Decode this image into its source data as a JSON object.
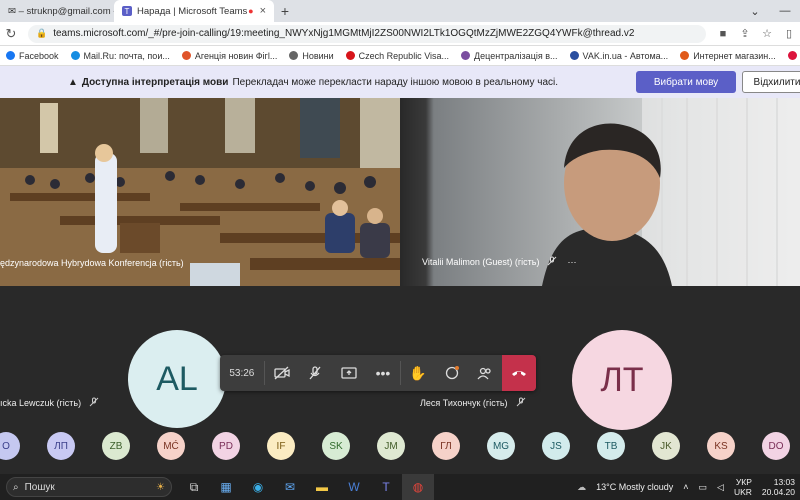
{
  "browser": {
    "tabs": [
      {
        "label": "✉ – struknp@gmail.com - Gm",
        "close": "×"
      },
      {
        "label": "Нарада | Microsoft Teams",
        "close": "×"
      }
    ],
    "new_tab": "+",
    "url": "teams.microsoft.com/_#/pre-join-calling/19:meeting_NWYxNjg1MGMtMjI2ZS00NWI2LTk1OGQtMzZjMWE2ZGQ4YWFk@thread.v2",
    "bookmarks": [
      {
        "label": "Facebook",
        "color": "#1877f2"
      },
      {
        "label": "Mail.Ru: почта, пои...",
        "color": "#168de2"
      },
      {
        "label": "Агенція новин Фігl...",
        "color": "#e0542a"
      },
      {
        "label": "Новини",
        "color": "#666666"
      },
      {
        "label": "Czech Republic Visa...",
        "color": "#d7141a"
      },
      {
        "label": "Децентралізація в...",
        "color": "#7b4fa0"
      },
      {
        "label": "VAK.in.ua - Автома...",
        "color": "#2a4fa0"
      },
      {
        "label": "Интернет магазин...",
        "color": "#e05a1a"
      },
      {
        "label": "Poland visa informa...",
        "color": "#dc143c"
      }
    ]
  },
  "banner": {
    "title": "Доступна інтерпретація мови",
    "text": "Перекладач може перекласти нараду іншою мовою в реальному часі.",
    "primary_button": "Вибрати мову",
    "secondary_button": "Відхилити"
  },
  "tiles": {
    "room_caption": "ędzynarodowa Hybrydowa Konferencja (гість)",
    "guest_caption": "Vitalii Malimon (Guest) (гість)",
    "guest_more": "···"
  },
  "participants_big": [
    {
      "initials": "AL",
      "name": "ıcka Lewczuk (гість)"
    },
    {
      "initials": "ЛТ",
      "name": "Леся Тихончук (гість)"
    }
  ],
  "call_bar": {
    "timer": "53:26"
  },
  "participants_small": [
    {
      "initials": "O",
      "bg": "#c5c8f0",
      "fg": "#3a3f8a"
    },
    {
      "initials": "ЛП",
      "bg": "#c8c9f3",
      "fg": "#3a3f8a"
    },
    {
      "initials": "ZB",
      "bg": "#dbe9d0",
      "fg": "#3b5e2a"
    },
    {
      "initials": "MĆ",
      "bg": "#f6d2c9",
      "fg": "#7a3322"
    },
    {
      "initials": "PD",
      "bg": "#f2d3e4",
      "fg": "#7a2f58"
    },
    {
      "initials": "IF",
      "bg": "#fbecc2",
      "fg": "#7a5a12"
    },
    {
      "initials": "SK",
      "bg": "#d7ecd4",
      "fg": "#2f6a2a"
    },
    {
      "initials": "JM",
      "bg": "#dfe9d2",
      "fg": "#435e2a"
    },
    {
      "initials": "ГЛ",
      "bg": "#f6d2c9",
      "fg": "#7a3322"
    },
    {
      "initials": "MG",
      "bg": "#d6ecec",
      "fg": "#1d5a62"
    },
    {
      "initials": "JS",
      "bg": "#d2ebec",
      "fg": "#1d5a62"
    },
    {
      "initials": "TB",
      "bg": "#d4ecec",
      "fg": "#1d5a62"
    },
    {
      "initials": "JK",
      "bg": "#e2e6d2",
      "fg": "#4a5a2a"
    },
    {
      "initials": "KS",
      "bg": "#f6d2c9",
      "fg": "#7a3322"
    },
    {
      "initials": "DO",
      "bg": "#f2d3e4",
      "fg": "#7a2f58"
    }
  ],
  "taskbar": {
    "search_text": "Пошук",
    "weather": "13°C  Mostly cloudy",
    "lang_line1": "УКР",
    "lang_line2": "UKR",
    "time": "13:03",
    "date": "20.04.20"
  }
}
